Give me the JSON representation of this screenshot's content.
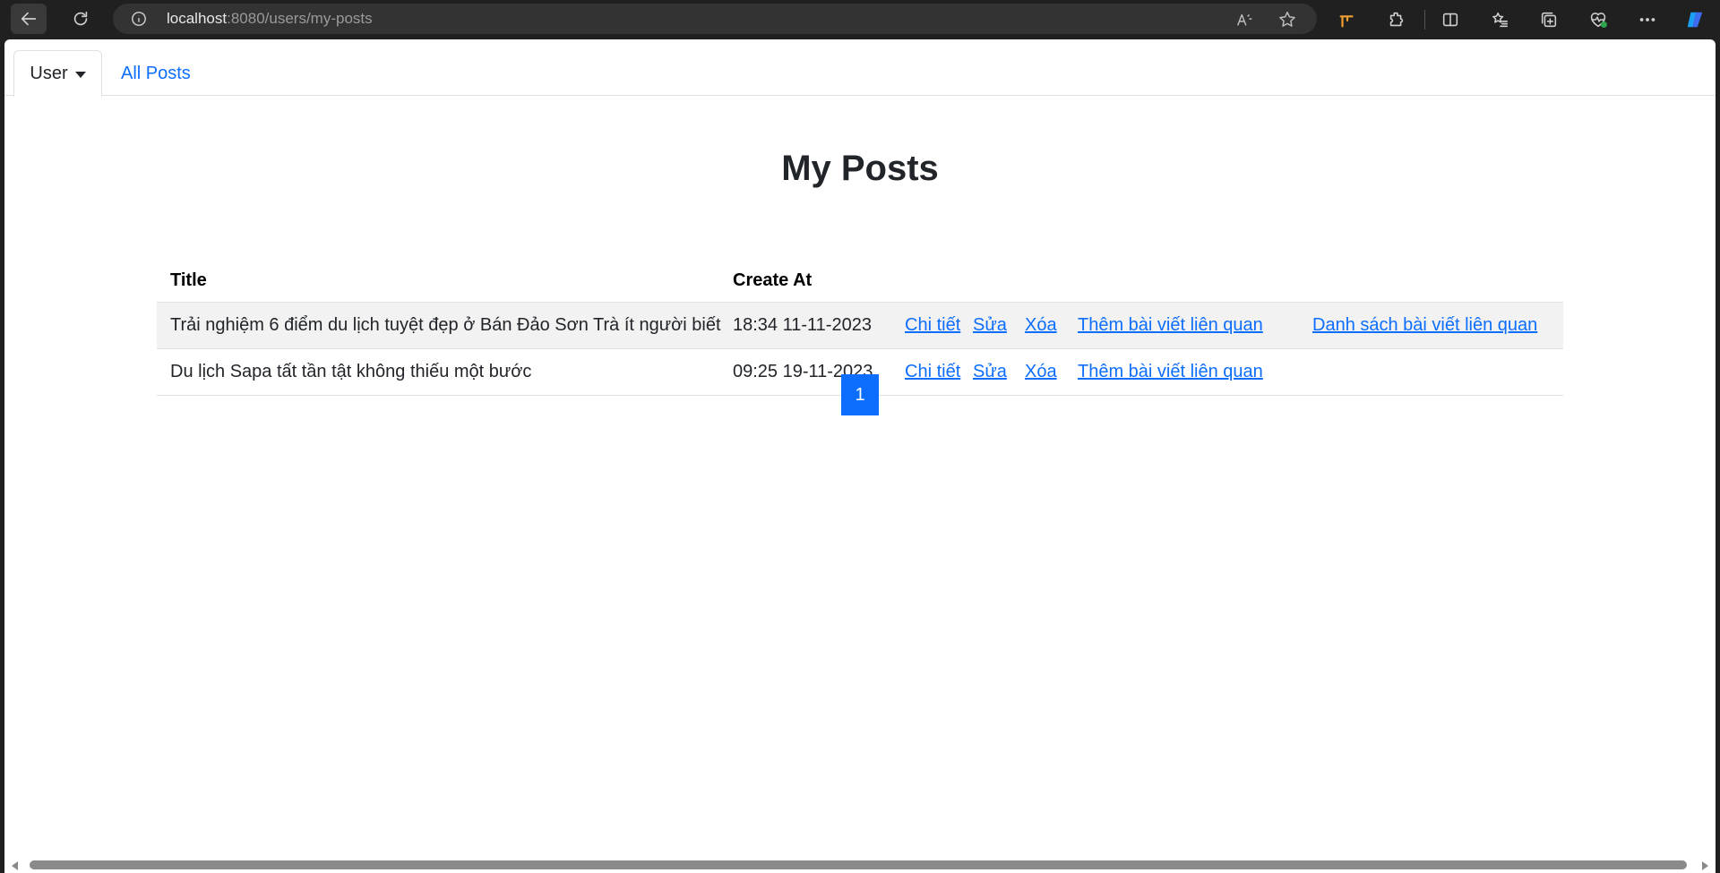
{
  "browser": {
    "url_host": "localhost",
    "url_rest": ":8080/users/my-posts"
  },
  "nav": {
    "user_tab": "User",
    "all_posts_tab": "All Posts"
  },
  "page_title": "My Posts",
  "table": {
    "headers": [
      "Title",
      "Create At"
    ],
    "rows": [
      {
        "title": "Trải nghiệm 6 điểm du lịch tuyệt đẹp ở Bán Đảo Sơn Trà ít người biết",
        "created_at": "18:34 11-11-2023",
        "actions": [
          "Chi tiết",
          "Sửa",
          "Xóa",
          "Thêm bài viết liên quan",
          "Danh sách bài viết liên quan"
        ]
      },
      {
        "title": "Du lịch Sapa tất tần tật không thiếu một bước",
        "created_at": "09:25 19-11-2023",
        "actions": [
          "Chi tiết",
          "Sửa",
          "Xóa",
          "Thêm bài viết liên quan"
        ]
      }
    ]
  },
  "pagination": {
    "current_page": "1"
  },
  "colors": {
    "primary": "#0d6efd",
    "text": "#212529",
    "stripe": "#f2f2f2"
  }
}
